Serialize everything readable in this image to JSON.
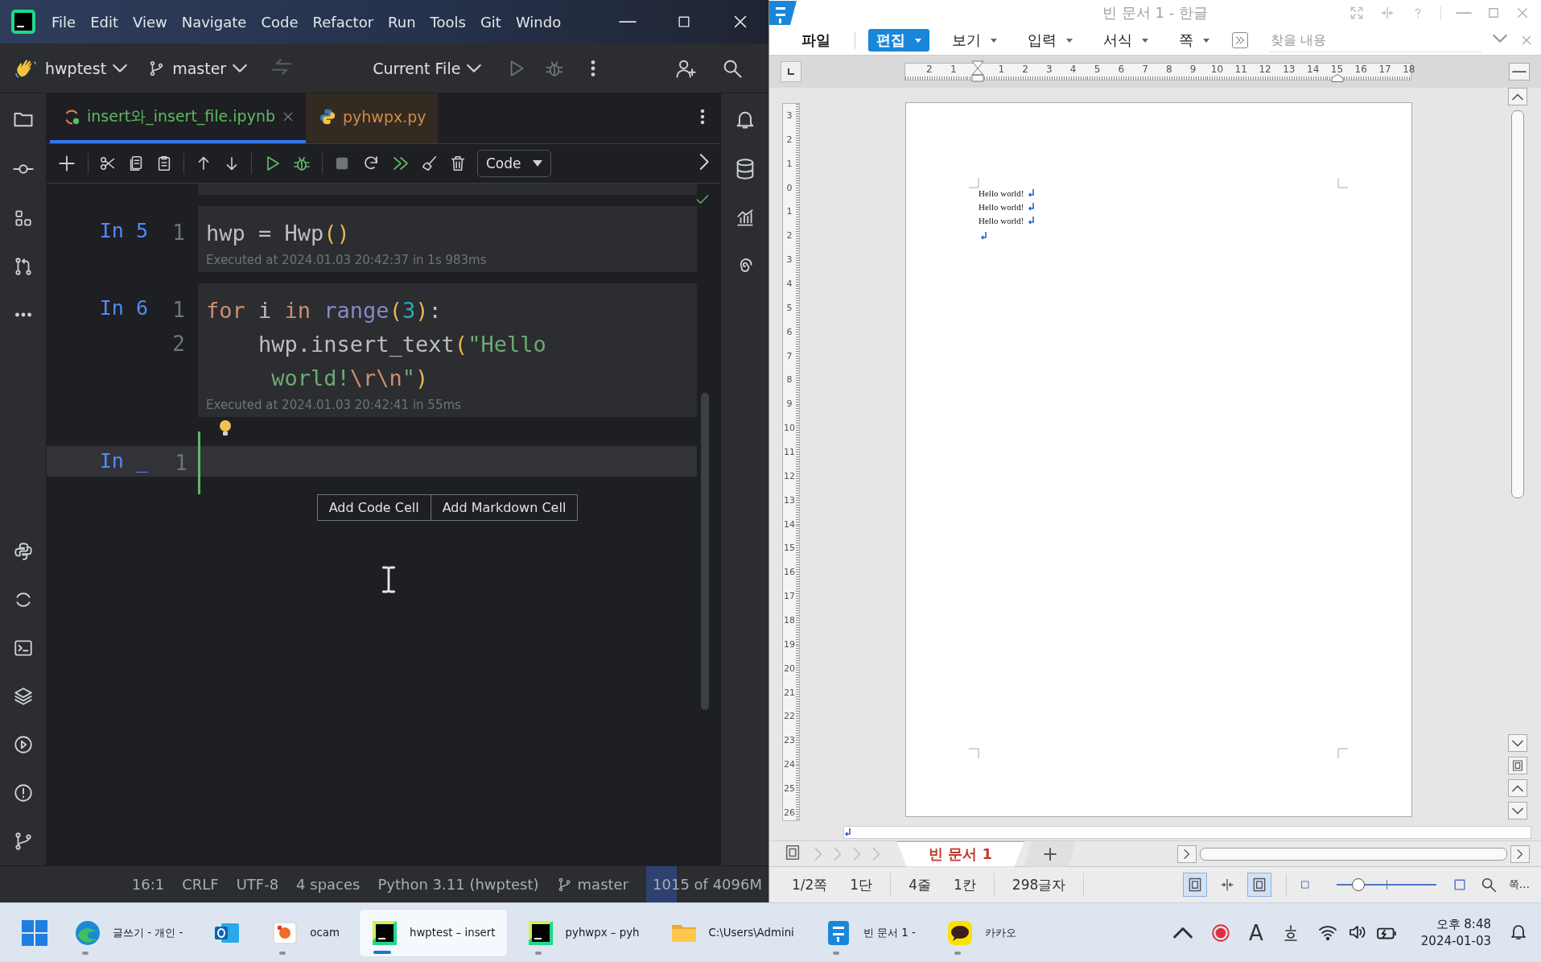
{
  "ide": {
    "menu": [
      "File",
      "Edit",
      "View",
      "Navigate",
      "Code",
      "Refactor",
      "Run",
      "Tools",
      "Git",
      "Windo"
    ],
    "project": "hwptest",
    "branch": "master",
    "run_config": "Current File",
    "tabs": [
      {
        "label": "insert와_insert_file.ipynb",
        "selected": true,
        "kind": "notebook",
        "color": "#5fb865"
      },
      {
        "label": "pyhwpx.py",
        "selected": false,
        "kind": "python",
        "color": "#d08a45"
      }
    ],
    "cell_type": "Code",
    "cells": [
      {
        "prompt": "In 5",
        "current": false,
        "lines": [
          {
            "number": "1",
            "tokens": [
              {
                "kind": "plain",
                "text": "hwp = Hwp"
              },
              {
                "kind": "paren",
                "text": "()"
              }
            ]
          }
        ],
        "executed": "Executed at 2024.01.03 20:42:37 in 1s 983ms"
      },
      {
        "prompt": "In 6",
        "current": false,
        "lines": [
          {
            "number": "1",
            "tokens": [
              {
                "kind": "keyword",
                "text": "for"
              },
              {
                "kind": "plain",
                "text": " i "
              },
              {
                "kind": "keyword",
                "text": "in"
              },
              {
                "kind": "builtin",
                "text": " range"
              },
              {
                "kind": "paren",
                "text": "("
              },
              {
                "kind": "number",
                "text": "3"
              },
              {
                "kind": "paren",
                "text": ")"
              },
              {
                "kind": "plain",
                "text": ":"
              }
            ]
          },
          {
            "number": "2",
            "tokens": [
              {
                "kind": "plain",
                "text": "    hwp.insert_text"
              },
              {
                "kind": "paren",
                "text": "("
              },
              {
                "kind": "string",
                "text": "\"Hello"
              }
            ]
          },
          {
            "tokens": [
              {
                "kind": "string",
                "text": "     world!"
              },
              {
                "kind": "escape",
                "text": "\\r\\n"
              },
              {
                "kind": "string",
                "text": "\""
              },
              {
                "kind": "paren",
                "text": ")"
              }
            ]
          }
        ],
        "executed": "Executed at 2024.01.03 20:42:41 in 55ms"
      },
      {
        "prompt": "In _",
        "current": true,
        "lines": [
          {
            "number": "1"
          }
        ]
      }
    ],
    "add_cell_buttons": [
      "Add Code Cell",
      "Add Markdown Cell"
    ],
    "status_bar": {
      "position": "16:1",
      "line_ending": "CRLF",
      "encoding": "UTF-8",
      "indent": "4 spaces",
      "interpreter": "Python 3.11 (hwptest)",
      "branch": "master",
      "memory": {
        "text": "1015 of 4096M",
        "level": 0.25
      }
    }
  },
  "hwp": {
    "title": "빈 문서 1 - 한글",
    "menu": [
      {
        "label": "파일",
        "selected": false,
        "dropdown": false
      },
      {
        "label": "편집",
        "selected": true,
        "dropdown": true
      },
      {
        "label": "보기",
        "selected": false,
        "dropdown": true
      },
      {
        "label": "입력",
        "selected": false,
        "dropdown": true
      },
      {
        "label": "서식",
        "selected": false,
        "dropdown": true
      },
      {
        "label": "쪽",
        "selected": false,
        "dropdown": true
      }
    ],
    "search_placeholder": "찾을 내용",
    "ruler": {
      "before_zero": [
        "2",
        "1"
      ],
      "after_zero": [
        "1",
        "2",
        "3",
        "4",
        "5",
        "6",
        "7",
        "8",
        "9",
        "10",
        "11",
        "12",
        "13",
        "14",
        "15",
        "16",
        "17",
        "18"
      ],
      "vertical": [
        "3",
        "2",
        "1",
        "0",
        "1",
        "2",
        "3",
        "4",
        "5",
        "6",
        "7",
        "8",
        "9",
        "10",
        "11",
        "12",
        "13",
        "14",
        "15",
        "16",
        "17",
        "18",
        "19",
        "20",
        "21",
        "22",
        "23",
        "24",
        "25",
        "26"
      ]
    },
    "document_lines": [
      "Hello world!",
      "Hello world!",
      "Hello world!"
    ],
    "doc_tabs": [
      {
        "label": "빈 문서 1",
        "selected": true
      }
    ],
    "add_tab": "+",
    "status": [
      "1/2쪽",
      "1단",
      "4줄",
      "1칸",
      "298글자"
    ],
    "view_modes": [
      {
        "selected": true
      },
      {
        "selected": false
      },
      {
        "selected": true
      }
    ],
    "zoom": {
      "level": 0.22
    },
    "page_menu": "쪽…"
  },
  "taskbar": {
    "apps": [
      {
        "kind": "edge",
        "label": "글쓰기 - 개인 -",
        "running": true,
        "selected": false
      },
      {
        "kind": "outlook",
        "running": false,
        "selected": false
      },
      {
        "kind": "ocam",
        "label": "ocam",
        "running": true,
        "selected": false
      },
      {
        "kind": "pycharm",
        "label": "hwptest – insert",
        "running": true,
        "selected": true
      },
      {
        "kind": "pycharm",
        "label": "pyhwpx – pyh",
        "running": true,
        "selected": false
      },
      {
        "kind": "folder",
        "label": "C:\\Users\\Admini",
        "running": false,
        "selected": false
      },
      {
        "kind": "hwp",
        "label": "빈 문서 1 -",
        "running": true,
        "selected": false
      },
      {
        "kind": "kakao",
        "label": "카카오",
        "running": true,
        "selected": false
      }
    ],
    "ime": "A",
    "clock": {
      "time": "오후 8:48",
      "date": "2024-01-03"
    }
  }
}
